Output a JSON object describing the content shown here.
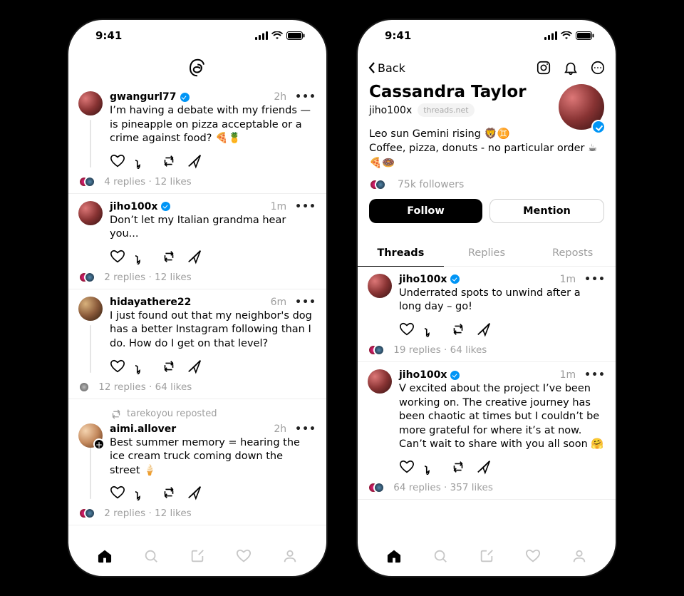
{
  "status_bar": {
    "time": "9:41"
  },
  "left": {
    "posts": [
      {
        "user": "gwangurl77",
        "verified": true,
        "time": "2h",
        "body": "I’m having a debate with my friends — is pineapple on pizza acceptable or a crime against food? 🍕🍍",
        "replies": "4 replies",
        "likes": "12 likes",
        "avatar_style": "default",
        "show_line": true
      },
      {
        "user": "jiho100x",
        "verified": true,
        "time": "1m",
        "body": "Don’t let my Italian grandma hear you...",
        "replies": "2 replies",
        "likes": "12 likes",
        "avatar_style": "default",
        "show_line": false
      },
      {
        "user": "hidayathere22",
        "verified": false,
        "time": "6m",
        "body": "I just found out that my neighbor's dog has a better Instagram following than I do. How do I get on that level?",
        "replies": "12 replies",
        "likes": "64 likes",
        "avatar_style": "alt1",
        "show_line": true,
        "single_mini": true
      },
      {
        "repost_by": "tarekoyou reposted",
        "user": "aimi.allover",
        "verified": false,
        "time": "2h",
        "body": "Best summer memory = hearing the ice cream truck coming down the street 🍦",
        "replies": "2 replies",
        "likes": "12 likes",
        "avatar_style": "alt3",
        "show_line": true,
        "has_add": true
      }
    ]
  },
  "right": {
    "back": "Back",
    "name": "Cassandra Taylor",
    "handle": "jiho100x",
    "domain": "threads.net",
    "bio_line1": "Leo sun Gemini rising 🦁♊️",
    "bio_line2": "Coffee, pizza, donuts - no particular order ☕🍕🍩",
    "followers": "75k followers",
    "follow": "Follow",
    "mention": "Mention",
    "tabs": {
      "threads": "Threads",
      "replies": "Replies",
      "reposts": "Reposts"
    },
    "posts": [
      {
        "user": "jiho100x",
        "verified": true,
        "time": "1m",
        "body": "Underrated spots to unwind after a long day – go!",
        "replies": "19 replies",
        "likes": "64 likes"
      },
      {
        "user": "jiho100x",
        "verified": true,
        "time": "1m",
        "body": "V excited about the project I’ve been working on. The creative journey has been chaotic at times but I couldn’t be more grateful for where it’s at now. Can’t wait to share with you all soon 🤗",
        "replies": "64 replies",
        "likes": "357 likes"
      }
    ]
  }
}
